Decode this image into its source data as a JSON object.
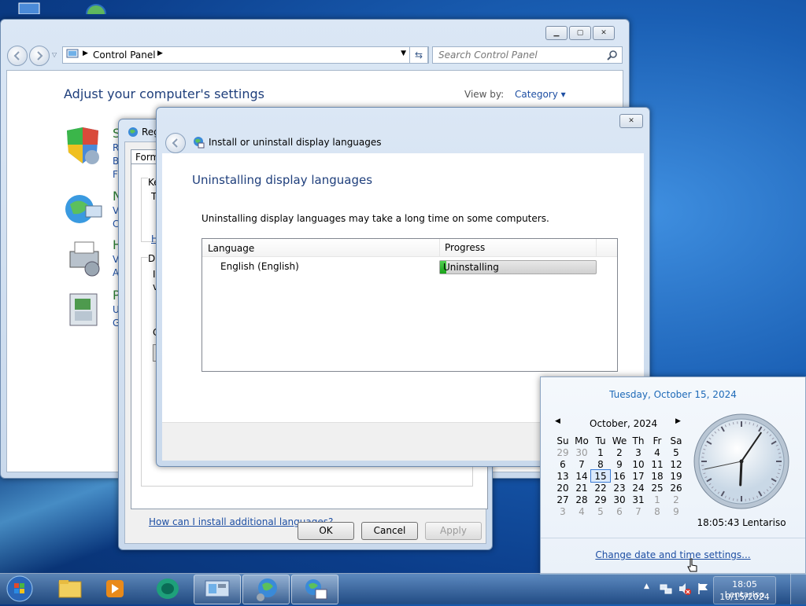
{
  "control_panel": {
    "address_text": "Control Panel",
    "search_placeholder": "Search Control Panel",
    "heading": "Adjust your computer's settings",
    "view_by_label": "View by:",
    "view_by_value": "Category",
    "categories": [
      {
        "letter": "S",
        "lines": [
          "Re",
          "Ba",
          "Fi"
        ]
      },
      {
        "letter": "N",
        "lines": [
          "Vi",
          "C"
        ]
      },
      {
        "letter": "H",
        "lines": [
          "Vi",
          "A"
        ]
      },
      {
        "letter": "P",
        "lines": [
          "U",
          "G"
        ]
      }
    ]
  },
  "region_window": {
    "title_fragment": "Reg",
    "tab_fragment": "Forma",
    "group_keyboards_fragment": "Ke",
    "text_fragment_1": "To",
    "link_fragment": "H",
    "group_display_fragment": "Di",
    "text_fragment_2": "In",
    "text_fragment_3": "vi",
    "text_fragment_4": "C",
    "install_link": "How can I install additional languages?",
    "ok_label": "OK",
    "cancel_label": "Cancel",
    "apply_label": "Apply"
  },
  "uninstall_dialog": {
    "title": "Install or uninstall display languages",
    "heading": "Uninstalling display languages",
    "description": "Uninstalling display languages may take a long time on some computers.",
    "columns": [
      "Language",
      "Progress"
    ],
    "rows": [
      {
        "language": "English (English)",
        "status": "Uninstalling",
        "progress": 0.04
      }
    ]
  },
  "clock_flyout": {
    "date_header": "Tuesday, October 15, 2024",
    "month_label": "October, 2024",
    "weekdays": [
      "Su",
      "Mo",
      "Tu",
      "We",
      "Th",
      "Fr",
      "Sa"
    ],
    "weeks": [
      [
        "29",
        "30",
        "1",
        "2",
        "3",
        "4",
        "5"
      ],
      [
        "6",
        "7",
        "8",
        "9",
        "10",
        "11",
        "12"
      ],
      [
        "13",
        "14",
        "15",
        "16",
        "17",
        "18",
        "19"
      ],
      [
        "20",
        "21",
        "22",
        "23",
        "24",
        "25",
        "26"
      ],
      [
        "27",
        "28",
        "29",
        "30",
        "31",
        "1",
        "2"
      ],
      [
        "3",
        "4",
        "5",
        "6",
        "7",
        "8",
        "9"
      ]
    ],
    "today": "15",
    "clock_caption": "18:05:43 Lentariso",
    "settings_link": "Change date and time settings...",
    "clock_time": {
      "h": 18,
      "m": 5,
      "s": 43
    }
  },
  "taskbar": {
    "tray_time": "18:05 Lentariso",
    "tray_date": "10/15/2024",
    "pinned": [
      "start-orb",
      "windows-explorer",
      "media-player",
      "app-globe",
      "control-panel",
      "language-setup",
      "region-settings"
    ]
  },
  "colors": {
    "link": "#1e4fa3",
    "heading": "#1e3e7b",
    "progress_fill": "#1aa31a"
  }
}
